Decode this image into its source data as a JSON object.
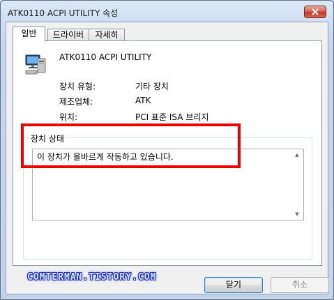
{
  "window": {
    "title": "ATK0110 ACPI UTILITY 속성"
  },
  "tabs": [
    {
      "label": "일반",
      "active": true
    },
    {
      "label": "드라이버",
      "active": false
    },
    {
      "label": "자세히",
      "active": false
    }
  ],
  "device": {
    "name": "ATK0110 ACPI UTILITY",
    "icon": "monitor-computer-icon"
  },
  "properties": [
    {
      "label": "장치 유형:",
      "value": "기타 장치"
    },
    {
      "label": "제조업체:",
      "value": "ATK"
    },
    {
      "label": "위치:",
      "value": "PCI 표준 ISA 브리지"
    }
  ],
  "status": {
    "legend": "장치 상태",
    "text": "이 장치가 올바르게 작동하고 있습니다."
  },
  "watermark": "COMTERMAN.TISTORY.COM",
  "buttons": {
    "close_label": "닫기",
    "cancel_label": "취소"
  },
  "colors": {
    "highlight": "#ee0000",
    "watermark_outline": "#1c2fb7"
  }
}
